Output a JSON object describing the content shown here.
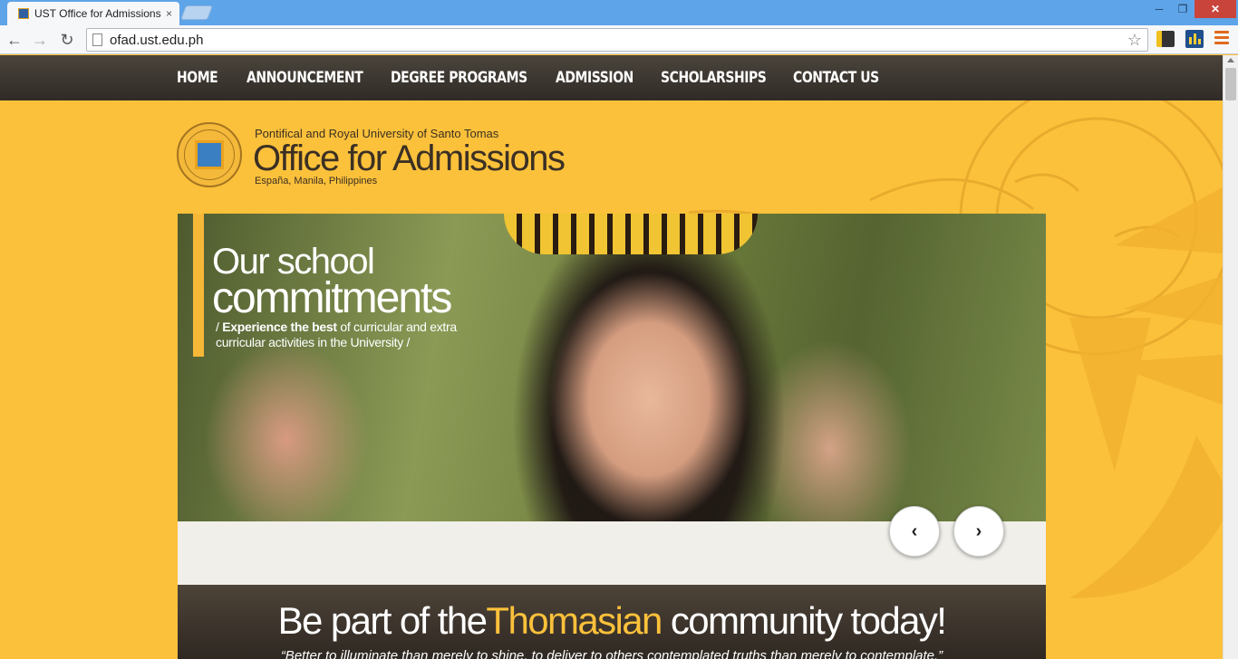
{
  "browser": {
    "tab_title": "UST Office for Admissions",
    "tab_close": "×",
    "url": "ofad.ust.edu.ph",
    "min": "─",
    "max": "❐",
    "close": "✕",
    "back": "←",
    "forward": "→",
    "reload": "↻",
    "star": "☆"
  },
  "nav": {
    "items": [
      "HOME",
      "ANNOUNCEMENT",
      "DEGREE PROGRAMS",
      "ADMISSION",
      "SCHOLARSHIPS",
      "CONTACT US"
    ]
  },
  "header": {
    "org_top": "Pontifical and Royal University of Santo Tomas",
    "title": "Office for Admissions",
    "subtitle": "España, Manila, Philippines"
  },
  "hero": {
    "line1": "Our school",
    "line2": "commitments",
    "tag_prefix": "/ ",
    "tag_bold": "Experience the best",
    "tag_rest": " of curricular and extra curricular activities in the University /",
    "prev": "‹",
    "next": "›"
  },
  "cta": {
    "before": "Be part of the",
    "highlight": "Thomasian",
    "after": " community today!",
    "quote": "“Better to illuminate than merely to shine, to deliver to others contemplated truths than merely to contemplate.”"
  },
  "colors": {
    "page_bg": "#fcc13b",
    "nav_bg": "#302b26",
    "accent": "#f7b838"
  }
}
